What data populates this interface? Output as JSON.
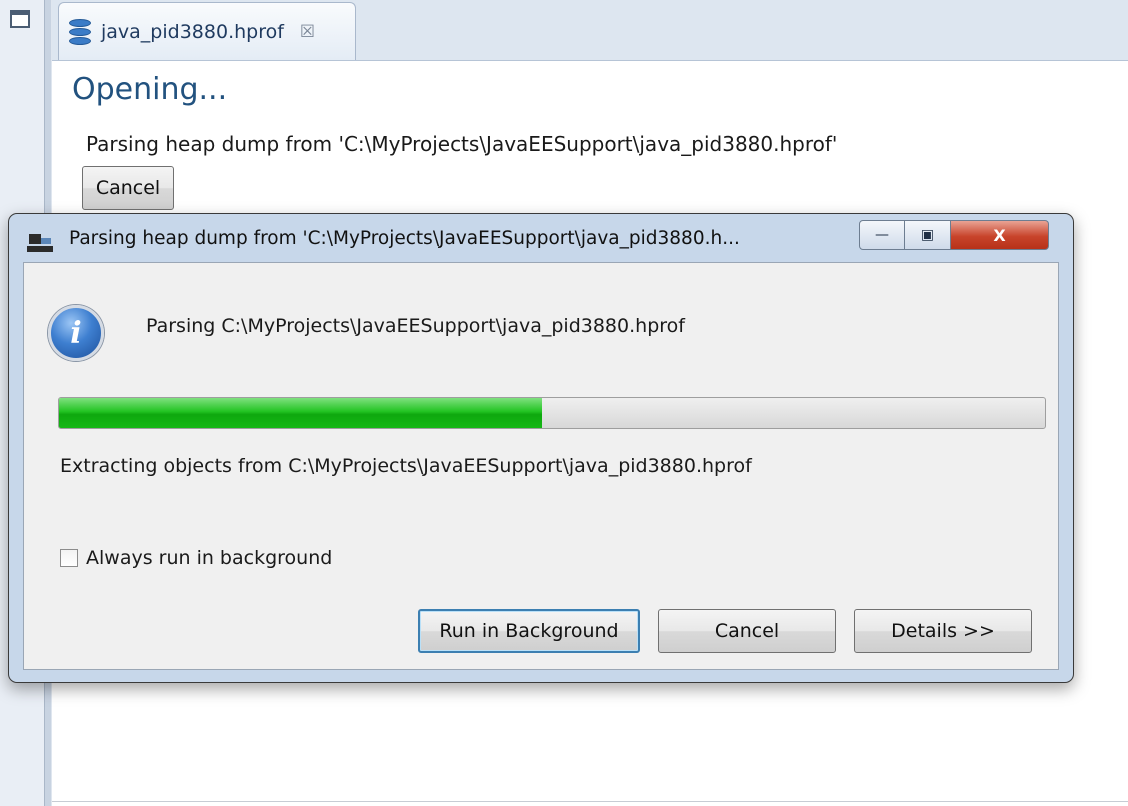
{
  "editor": {
    "tab": {
      "label": "java_pid3880.hprof",
      "close_glyph": "☒",
      "icon": "database-icon"
    },
    "heading": "Opening...",
    "message": "Parsing heap dump from 'C:\\MyProjects\\JavaEESupport\\java_pid3880.hprof'",
    "cancel_label": "Cancel"
  },
  "dialog": {
    "title": "Parsing heap dump from 'C:\\MyProjects\\JavaEESupport\\java_pid3880.h...",
    "window_buttons": {
      "minimize": "—",
      "maximize": "▣",
      "close": "X"
    },
    "info_icon_glyph": "i",
    "task": "Parsing C:\\MyProjects\\JavaEESupport\\java_pid3880.hprof",
    "progress": 0.49,
    "subtask": "Extracting objects from C:\\MyProjects\\JavaEESupport\\java_pid3880.hprof",
    "checkbox": {
      "label": "Always run in background",
      "checked": false
    },
    "buttons": {
      "run_in_background": "Run in Background",
      "cancel": "Cancel",
      "details": "Details >>"
    }
  },
  "colors": {
    "heading": "#22527f",
    "progress_fill": "#22c422",
    "dialog_frame": "#c7d7ea"
  }
}
